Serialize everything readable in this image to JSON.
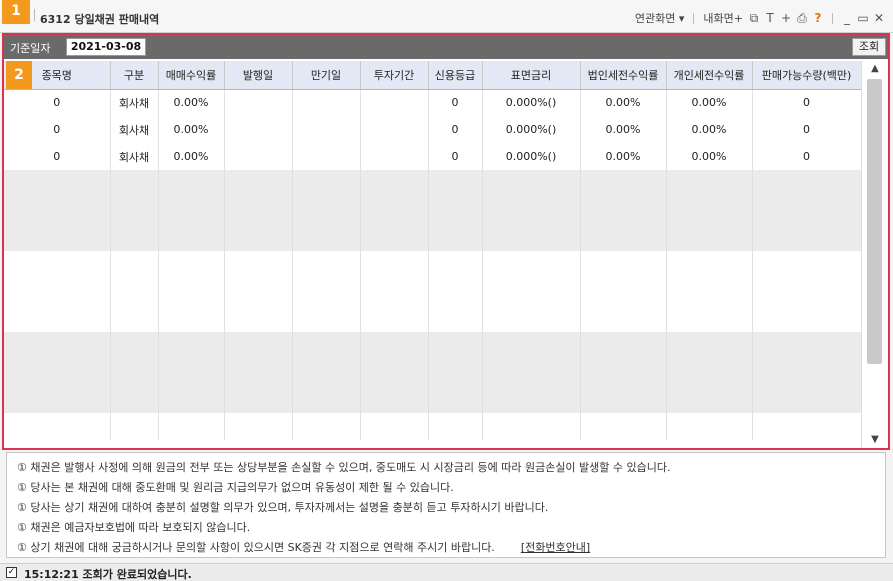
{
  "window": {
    "badge": "1",
    "title": "6312 당일채권 판매내역",
    "menu_related": "연관화면",
    "menu_my": "내화면",
    "icons": [
      "window-icon",
      "text-icon",
      "plus-icon",
      "print-icon",
      "help-icon",
      "minimize-icon",
      "maximize-icon",
      "close-icon"
    ]
  },
  "filter": {
    "date_label": "기준일자",
    "date_value": "2021-03-08",
    "query_button": "조회"
  },
  "grid": {
    "badge": "2",
    "columns": [
      "종목명",
      "구분",
      "매매수익률",
      "발행일",
      "만기일",
      "투자기간",
      "신용등급",
      "표면금리",
      "법인세전수익률",
      "개인세전수익률",
      "판매가능수량(백만)"
    ],
    "rows": [
      [
        "0",
        "회사채",
        "0.00%",
        "",
        "",
        "",
        "0",
        "0.000%()",
        "0.00%",
        "0.00%",
        "0"
      ],
      [
        "0",
        "회사채",
        "0.00%",
        "",
        "",
        "",
        "0",
        "0.000%()",
        "0.00%",
        "0.00%",
        "0"
      ],
      [
        "0",
        "회사채",
        "0.00%",
        "",
        "",
        "",
        "0",
        "0.000%()",
        "0.00%",
        "0.00%",
        "0"
      ]
    ]
  },
  "notice": {
    "lines": [
      "① 채권은 발행사 사정에 의해 원금의 전부 또는 상당부분을 손실할 수 있으며, 중도매도 시 시장금리 등에 따라 원금손실이 발생할 수 있습니다.",
      "① 당사는 본 채권에 대해 중도환매 및 원리금 지급의무가 없으며 유동성이 제한 될 수 있습니다.",
      "① 당사는 상기 채권에 대하여 충분히 설명할 의무가 있으며, 투자자께서는 설명을 충분히 듣고 투자하시기 바랍니다.",
      "① 채권은 예금자보호법에 따라 보호되지 않습니다.",
      "① 상기 채권에 대해 궁금하시거나 문의할 사항이 있으시면 SK증권 각 지점으로 연락해 주시기 바랍니다."
    ],
    "phone_link": "[전화번호안내]"
  },
  "status": {
    "text": "15:12:21 조회가 완료되었습니다."
  }
}
